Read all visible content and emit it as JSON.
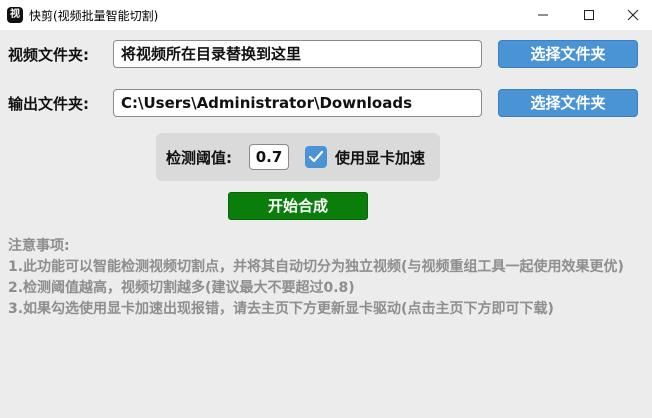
{
  "window": {
    "title": "快剪(视频批量智能切割)",
    "icon_glyph": "视"
  },
  "video_folder": {
    "label": "视频文件夹:",
    "value": "将视频所在目录替换到这里",
    "button_label": "选择文件夹"
  },
  "output_folder": {
    "label": "输出文件夹:",
    "value": "C:\\Users\\Administrator\\Downloads",
    "button_label": "选择文件夹"
  },
  "threshold": {
    "label": "检测阈值:",
    "value": "0.7"
  },
  "gpu": {
    "label": "使用显卡加速",
    "checked": true
  },
  "start_button": {
    "label": "开始合成"
  },
  "notes": {
    "heading": "注意事项:",
    "items": [
      "1.此功能可以智能检测视频切割点，并将其自动切分为独立视频(与视频重组工具一起使用效果更优)",
      "2.检测阈值越高，视频切割越多(建议最大不要超过0.8)",
      "3.如果勾选使用显卡加速出现报错，请去主页下方更新显卡驱动(点击主页下方即可下载)"
    ]
  },
  "colors": {
    "accent_blue": "#4a93d4",
    "start_green": "#0a7d0a",
    "note_gray": "#8e8e8e",
    "background": "#ececec"
  },
  "icons": {
    "minimize": "minimize-icon",
    "maximize": "maximize-icon",
    "close": "close-icon",
    "checkbox": "checkmark-icon"
  }
}
